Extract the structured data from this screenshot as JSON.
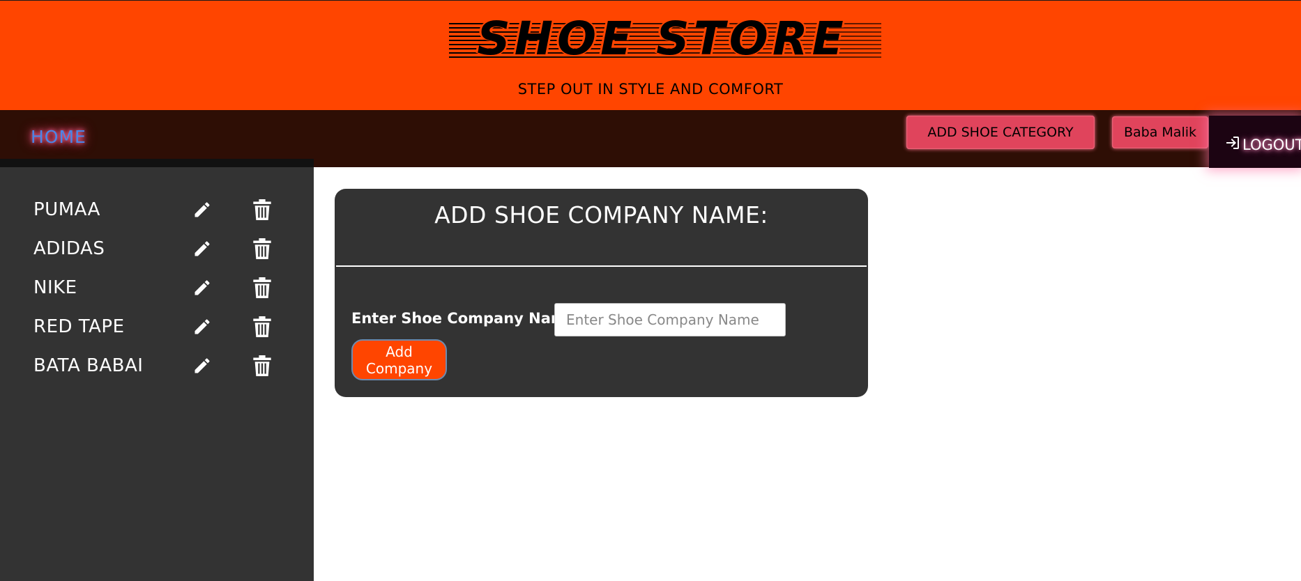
{
  "header": {
    "brand": "SHOE STORE",
    "tagline": "STEP OUT IN STYLE AND COMFORT"
  },
  "nav": {
    "home": "HOME",
    "add_category": "ADD SHOE CATEGORY",
    "user": "Baba Malik",
    "logout": "LOGOUT"
  },
  "sidebar": {
    "items": [
      {
        "label": "PUMAA"
      },
      {
        "label": "ADIDAS"
      },
      {
        "label": "NIKE"
      },
      {
        "label": "RED TAPE"
      },
      {
        "label": "BATA BABAI"
      }
    ],
    "icons": {
      "edit": "pencil-icon",
      "delete": "trash-icon"
    }
  },
  "form": {
    "title": "ADD SHOE COMPANY NAME:",
    "label": "Enter Shoe Company Name:",
    "placeholder": "Enter Shoe Company Name",
    "value": "",
    "submit": "Add Company"
  },
  "colors": {
    "header_bg": "#ff4500",
    "nav_bg": "#2e0e05",
    "panel_bg": "#333333",
    "nav_button": "#e0445c",
    "submit_button": "#ff4500"
  }
}
